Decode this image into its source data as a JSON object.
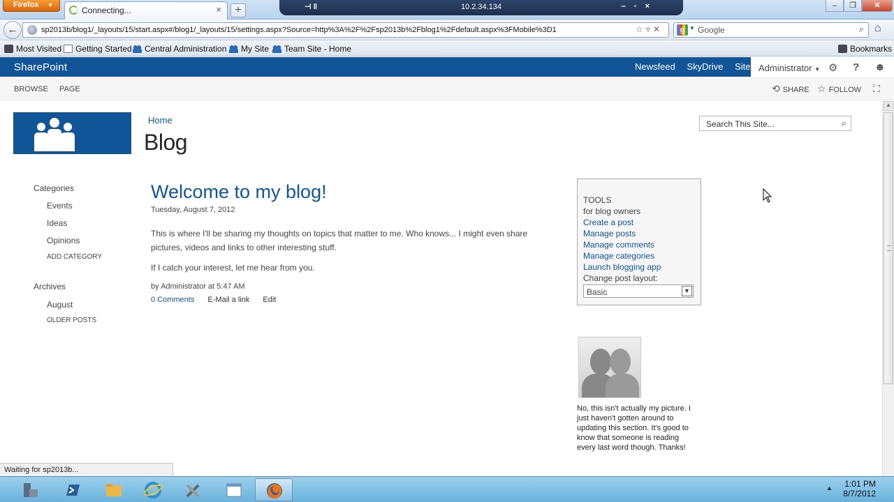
{
  "browser": {
    "app_button": "Firefox",
    "tab_title": "Connecting...",
    "remote_ip": "10.2.34.134",
    "url": "sp2013b/blog1/_layouts/15/start.aspx#/blog1/_layouts/15/settings.aspx?Source=http%3A%2F%2Fsp2013b%2Fblog1%2Fdefault.aspx%3FMobile%3D1",
    "search_engine": "Google",
    "search_placeholder": "Google"
  },
  "bookmarks": {
    "items": [
      "Most Visited",
      "Getting Started",
      "Central Administration",
      "My Site",
      "Team Site - Home"
    ],
    "right": "Bookmarks"
  },
  "suitebar": {
    "brand": "SharePoint",
    "links": [
      "Newsfeed",
      "SkyDrive",
      "Sites"
    ],
    "user": "Administrator"
  },
  "ribbon": {
    "tabs": [
      "BROWSE",
      "PAGE"
    ],
    "share": "SHARE",
    "follow": "FOLLOW"
  },
  "site": {
    "breadcrumb": "Home",
    "title": "Blog",
    "search_placeholder": "Search This Site..."
  },
  "leftnav": {
    "categories_heading": "Categories",
    "categories": [
      "Events",
      "Ideas",
      "Opinions"
    ],
    "add_category": "ADD CATEGORY",
    "archives_heading": "Archives",
    "archives": [
      "August"
    ],
    "older_posts": "OLDER POSTS"
  },
  "post": {
    "title": "Welcome to my blog!",
    "date": "Tuesday, August 7, 2012",
    "paragraph1": "This is where I'll be sharing my thoughts on topics that matter to me. Who knows... I might even share pictures, videos and links to other interesting stuff.",
    "paragraph2": "If I catch your interest, let me hear from you.",
    "byline": "by Administrator at 5:47 AM",
    "comments": "0 Comments",
    "email": "E-Mail a link",
    "edit": "Edit"
  },
  "tools": {
    "heading": "TOOLS",
    "subheading": "for blog owners",
    "links": [
      "Create a post",
      "Manage posts",
      "Manage comments",
      "Manage categories",
      "Launch blogging app"
    ],
    "layout_label": "Change post layout:",
    "layout_value": "Basic"
  },
  "about": {
    "caption": "No, this isn't actually my picture. I just haven't gotten around to updating this section. It's good to know that someone is reading every last word though. Thanks!"
  },
  "status": {
    "text": "Waiting for sp2013b..."
  },
  "taskbar": {
    "time": "1:01 PM",
    "date": "8/7/2012"
  },
  "colors": {
    "sharepoint_blue": "#0f5597",
    "taskbar": "#8cc7e8"
  }
}
